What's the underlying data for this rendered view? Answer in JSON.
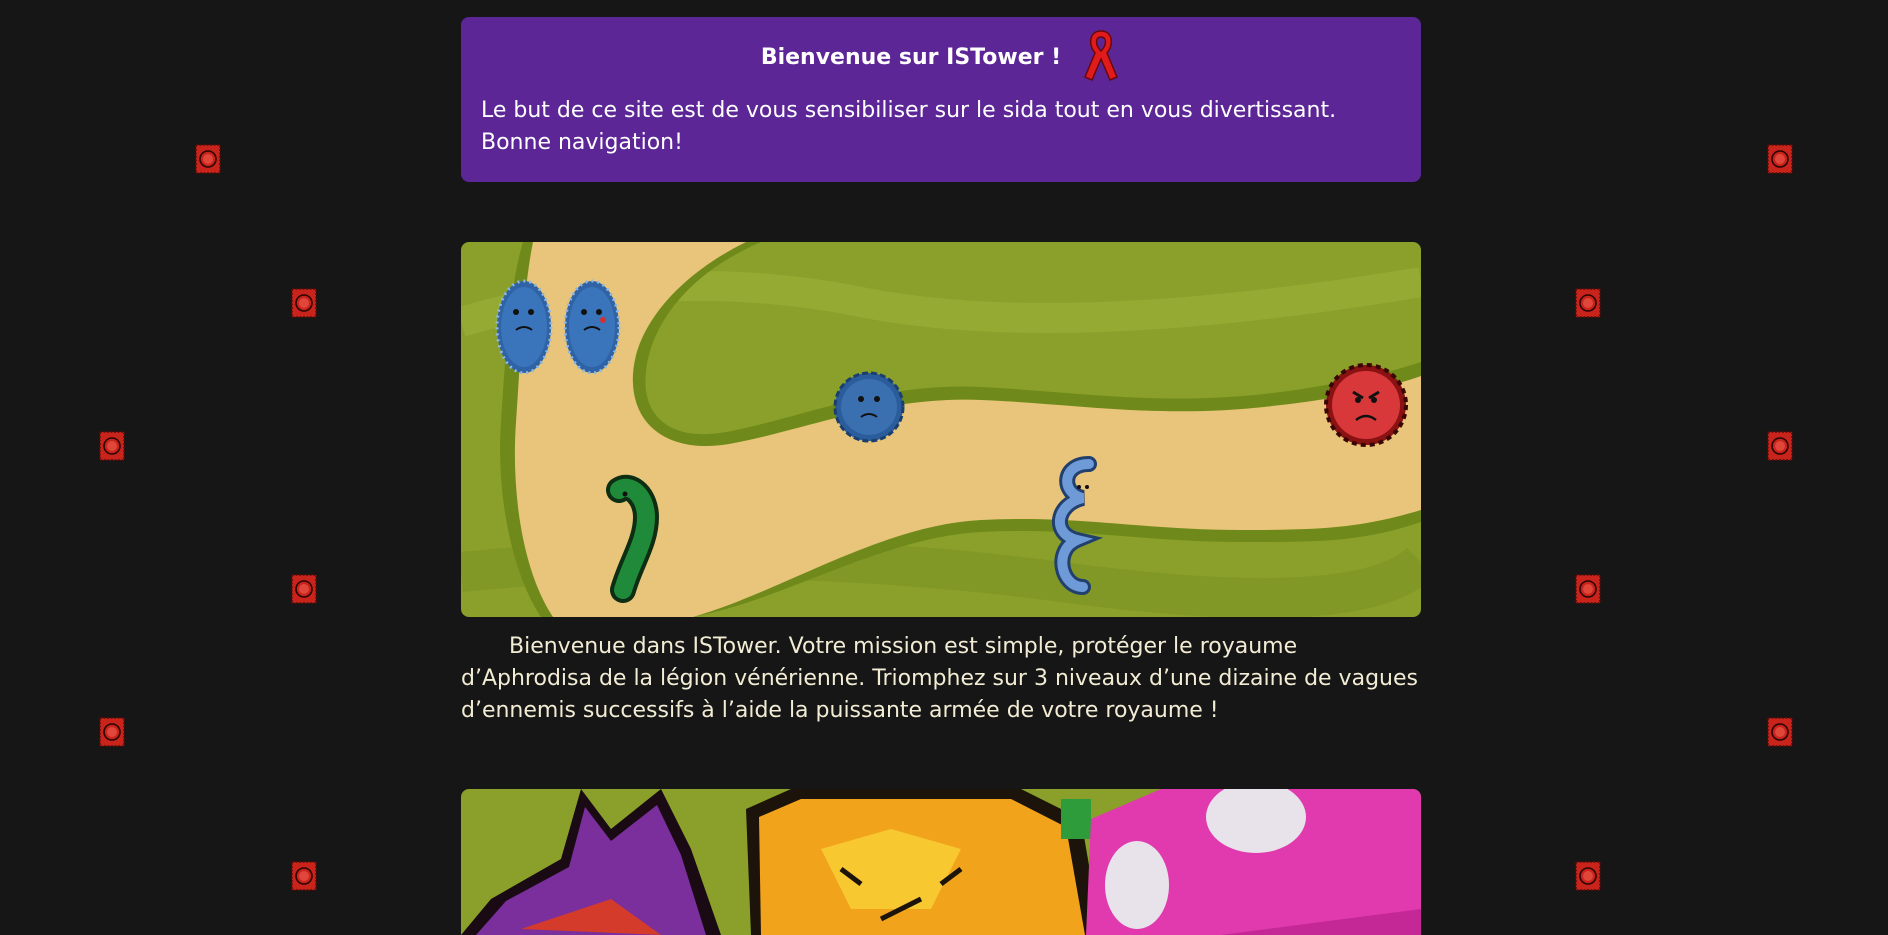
{
  "banner": {
    "title": "Bienvenue sur ISTower !",
    "text": "Le but de ce site est de vous sensibiliser sur le sida tout en vous divertissant. Bonne navigation!",
    "icon": "red-ribbon-icon",
    "background": "#5d2696"
  },
  "intro": {
    "text": "Bienvenue dans ISTower. Votre mission est simple, protéger le royaume d’Aphrodisa de la légion vénérienne. Triomphez sur 3 niveaux d’une dizaine de vagues d’ennemis successifs à l’aide la puissante armée de votre royaume !"
  },
  "decorations": {
    "icon": "condom-wrapper-icon",
    "color": "#d42a1e"
  },
  "colors": {
    "page_background": "#161616",
    "grass": "#8aa02a",
    "path": "#e8c57a"
  }
}
